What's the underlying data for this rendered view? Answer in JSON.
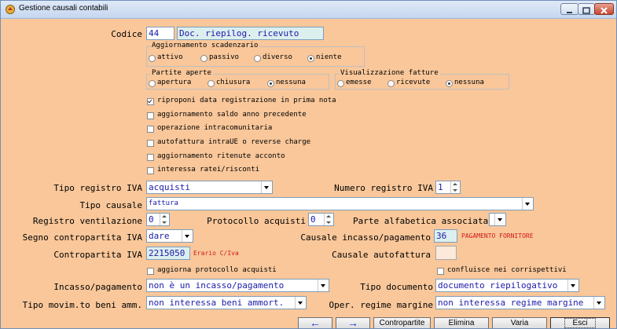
{
  "window": {
    "title": "Gestione causali contabili"
  },
  "codice": {
    "label": "Codice",
    "value": "44",
    "description": "Doc. riepilog. ricevuto"
  },
  "aggiornamento_scadenzario": {
    "title": "Aggiornamento scadenzario",
    "options": [
      "attivo",
      "passivo",
      "diverso",
      "niente"
    ],
    "selected": "niente"
  },
  "partite_aperte": {
    "title": "Partite aperte",
    "options": [
      "apertura",
      "chiusura",
      "nessuna"
    ],
    "selected": "nessuna"
  },
  "visualizzazione_fatture": {
    "title": "Visualizzazione fatture",
    "options": [
      "emesse",
      "ricevute",
      "nessuna"
    ],
    "selected": "nessuna"
  },
  "checkboxes": [
    {
      "label": "riproponi data registrazione in prima nota",
      "checked": true
    },
    {
      "label": "aggiornamento saldo anno precedente",
      "checked": false
    },
    {
      "label": "operazione intracomunitaria",
      "checked": false
    },
    {
      "label": "autofattura intraUE o reverse charge",
      "checked": false
    },
    {
      "label": "aggiornamento ritenute acconto",
      "checked": false
    },
    {
      "label": "interessa ratei/risconti",
      "checked": false
    }
  ],
  "tipo_registro_iva": {
    "label": "Tipo registro IVA",
    "value": "acquisti"
  },
  "numero_registro_iva": {
    "label": "Numero registro IVA",
    "value": "1"
  },
  "tipo_causale": {
    "label": "Tipo causale",
    "value": "fattura"
  },
  "registro_ventilazione": {
    "label": "Registro ventilazione",
    "value": "0"
  },
  "protocollo_acquisti": {
    "label": "Protocollo acquisti",
    "value": "0"
  },
  "parte_alfabetica": {
    "label": "Parte alfabetica associata",
    "value": ""
  },
  "segno_contropartita": {
    "label": "Segno contropartita IVA",
    "value": "dare"
  },
  "causale_incasso": {
    "label": "Causale incasso/pagamento",
    "value": "36",
    "description": "PAGAMENTO FORNITORE"
  },
  "contropartita_iva": {
    "label": "Contropartita IVA",
    "value": "2215050",
    "description": "Erario C/Iva"
  },
  "causale_autofattura": {
    "label": "Causale autofattura",
    "value": ""
  },
  "aggiorna_protocollo": {
    "label": "aggiorna protocollo acquisti",
    "checked": false
  },
  "confluisce_corrispettivi": {
    "label": "confluisce nei corrispettivi",
    "checked": false
  },
  "incasso_pagamento": {
    "label": "Incasso/pagamento",
    "value": "non è un incasso/pagamento"
  },
  "tipo_documento": {
    "label": "Tipo documento",
    "value": "documento riepilogativo"
  },
  "tipo_movimento_beni": {
    "label": "Tipo movim.to beni amm.",
    "value": "non interessa beni ammort."
  },
  "oper_regime_margine": {
    "label": "Oper. regime margine",
    "value": "non interessa regime margine"
  },
  "buttons": {
    "prev": "←",
    "next": "→",
    "contropartite": "Contropartite",
    "elimina": "Elimina",
    "varia": "Varia",
    "esci": "Esci"
  },
  "colors": {
    "background": "#f9c79a",
    "field_text": "#1a1aa8",
    "red_text": "#d21a1a",
    "arrow": "#1a2fd0"
  }
}
